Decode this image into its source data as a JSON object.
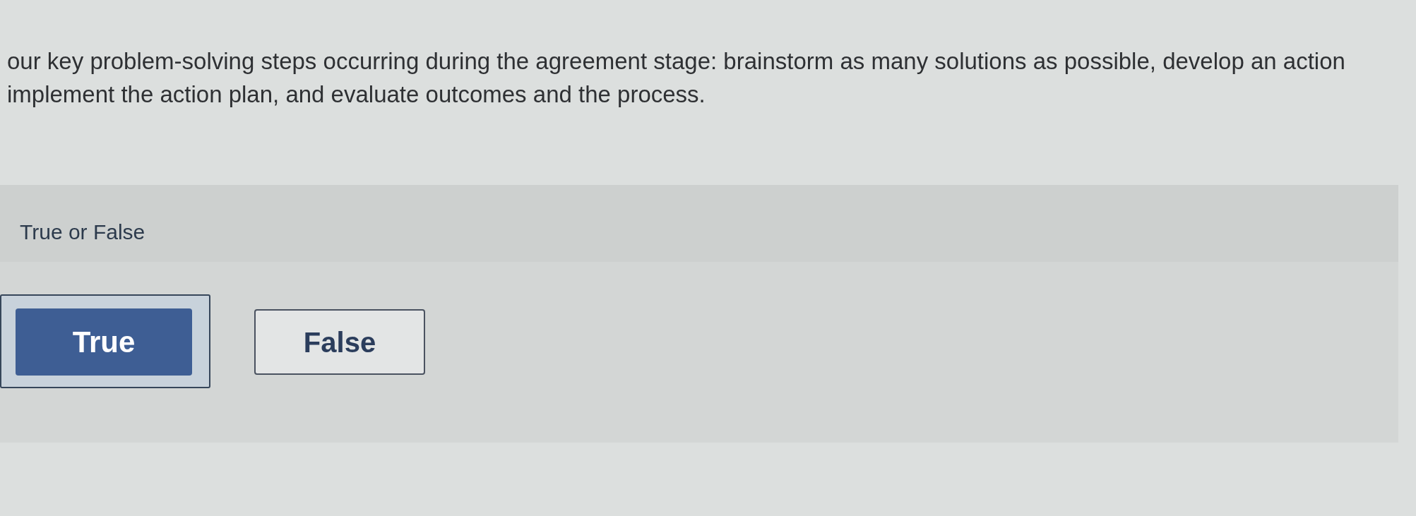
{
  "statement_lines": [
    "our key problem-solving steps occurring during the agreement stage: brainstorm as many solutions as possible, develop an action",
    "implement the action plan, and evaluate outcomes and the process."
  ],
  "question": {
    "prompt": "True or False",
    "options": [
      {
        "label": "True",
        "selected": true
      },
      {
        "label": "False",
        "selected": false
      }
    ]
  }
}
